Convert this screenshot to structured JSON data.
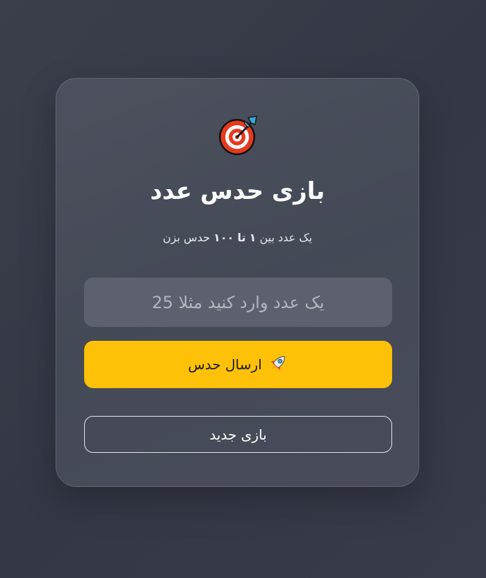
{
  "game": {
    "icon": "target-dart-icon",
    "title": "بازی حدس عدد",
    "subtitle_prefix": "یک عدد بین",
    "range_min": "۱",
    "subtitle_to": "تا",
    "range_max": "۱۰۰",
    "subtitle_suffix": "حدس بزن"
  },
  "input": {
    "value": "",
    "placeholder": "یک عدد وارد کنید مثلا 25"
  },
  "buttons": {
    "submit_label": "ارسال حدس",
    "submit_icon": "rocket-icon",
    "new_game_label": "بازی جدید"
  },
  "colors": {
    "accent": "#ffc107",
    "card_bg": "#4a4e5c",
    "input_bg": "#5d606e",
    "page_bg": "#373b48"
  }
}
